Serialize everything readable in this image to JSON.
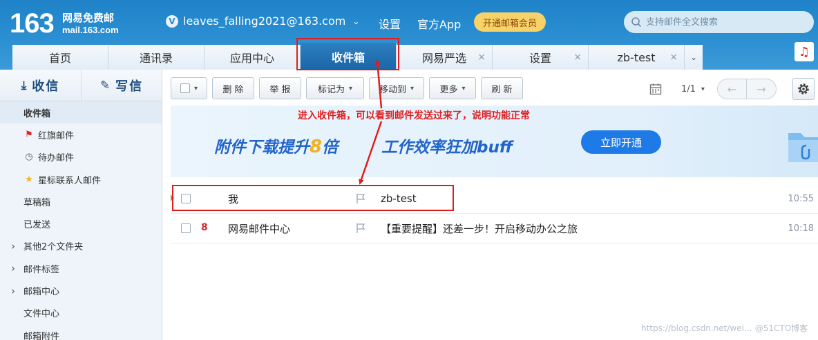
{
  "header": {
    "logo_number": "163",
    "logo_name": "网易免费邮",
    "logo_domain": "mail.163.com",
    "account_email": "leaves_falling2021@163.com",
    "settings_link": "设置",
    "app_link": "官方App",
    "vip_button": "开通邮箱会员",
    "search_placeholder": "支持邮件全文搜索"
  },
  "tabs": [
    {
      "label": "首页",
      "closable": false,
      "active": false
    },
    {
      "label": "通讯录",
      "closable": false,
      "active": false
    },
    {
      "label": "应用中心",
      "closable": false,
      "active": false
    },
    {
      "label": "收件箱",
      "closable": false,
      "active": true
    },
    {
      "label": "网易严选",
      "closable": true,
      "active": false
    },
    {
      "label": "设置",
      "closable": true,
      "active": false
    },
    {
      "label": "zb-test",
      "closable": true,
      "active": false
    }
  ],
  "tab_close_glyph": "×",
  "sidebar": {
    "receive_label": "收信",
    "compose_label": "写信",
    "folders": [
      {
        "label": "收件箱",
        "icon": "",
        "expandable": false,
        "active": true
      },
      {
        "label": "红旗邮件",
        "icon": "red-flag-icon",
        "expandable": false,
        "active": false
      },
      {
        "label": "待办邮件",
        "icon": "clock-icon",
        "expandable": false,
        "active": false
      },
      {
        "label": "星标联系人邮件",
        "icon": "star-icon",
        "expandable": false,
        "active": false
      },
      {
        "label": "草稿箱",
        "icon": "",
        "expandable": false,
        "active": false
      },
      {
        "label": "已发送",
        "icon": "",
        "expandable": false,
        "active": false
      },
      {
        "label": "其他2个文件夹",
        "icon": "",
        "expandable": true,
        "active": false
      },
      {
        "label": "邮件标签",
        "icon": "",
        "expandable": true,
        "active": false
      },
      {
        "label": "邮箱中心",
        "icon": "",
        "expandable": true,
        "active": false
      },
      {
        "label": "文件中心",
        "icon": "",
        "expandable": false,
        "active": false
      },
      {
        "label": "邮箱附件",
        "icon": "",
        "expandable": false,
        "active": false
      }
    ]
  },
  "toolbar": {
    "delete": "删 除",
    "report": "举 报",
    "mark_as": "标记为",
    "move_to": "移动到",
    "more": "更多",
    "refresh": "刷 新",
    "page_indicator": "1/1"
  },
  "banner": {
    "text_part1": "附件下载提升",
    "text_number": "8",
    "text_part2": "倍",
    "text_part3": "工作效率狂加buff",
    "button": "立即开通"
  },
  "annotation": "进入收件箱，可以看到邮件发送过来了，说明功能正常",
  "mails": [
    {
      "sender": "我",
      "subject": "zb-test",
      "time": "10:55",
      "has_marker": true,
      "has_app_icon": false
    },
    {
      "sender": "网易邮件中心",
      "subject": "【重要提醒】还差一步！开启移动办公之旅",
      "time": "10:18",
      "has_marker": false,
      "has_app_icon": true
    }
  ],
  "watermark": "https://blog.csdn.net/wei… @51CTO博客",
  "colors": {
    "brand_blue": "#2b8fd2",
    "annotation_red": "#e01d1d",
    "vip_gold": "#f7d269"
  }
}
